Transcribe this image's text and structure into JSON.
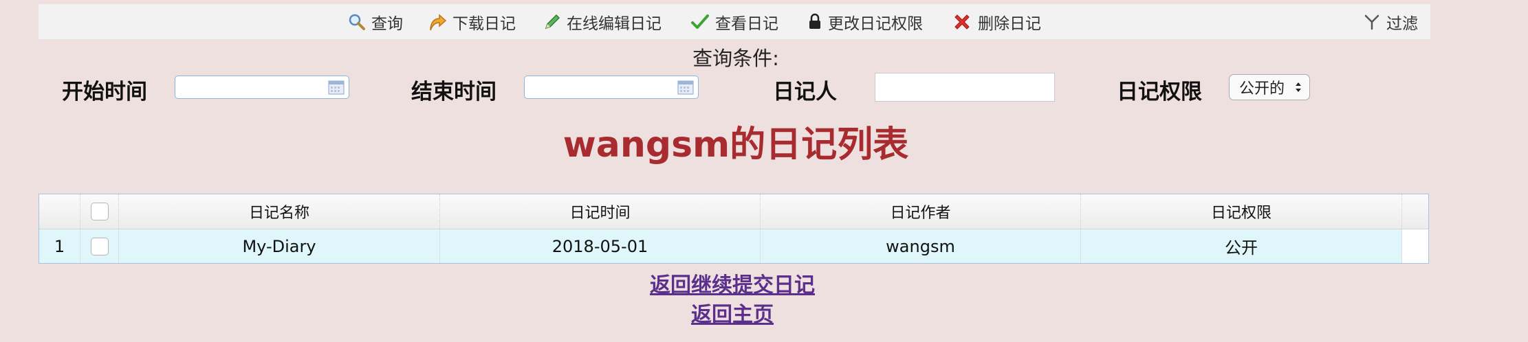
{
  "toolbar": {
    "query": "查询",
    "download": "下载日记",
    "edit_online": "在线编辑日记",
    "view": "查看日记",
    "change_permission": "更改日记权限",
    "delete": "删除日记",
    "filter": "过滤"
  },
  "query_section": {
    "title": "查询条件:",
    "start_time_label": "开始时间",
    "end_time_label": "结束时间",
    "author_label": "日记人",
    "permission_label": "日记权限",
    "start_time_value": "",
    "end_time_value": "",
    "author_value": "",
    "permission_selected": "公开的"
  },
  "list_title": "wangsm的日记列表",
  "table": {
    "columns": [
      "日记名称",
      "日记时间",
      "日记作者",
      "日记权限"
    ],
    "rows": [
      {
        "index": "1",
        "name": "My-Diary",
        "time": "2018-05-01",
        "author": "wangsm",
        "permission": "公开"
      }
    ]
  },
  "links": {
    "back_submit": "返回继续提交日记",
    "back_home": "返回主页"
  },
  "colors": {
    "background": "#efe0e0",
    "title": "#a82b2f",
    "link": "#5c2f8c",
    "row_highlight": "#dff6fa"
  }
}
